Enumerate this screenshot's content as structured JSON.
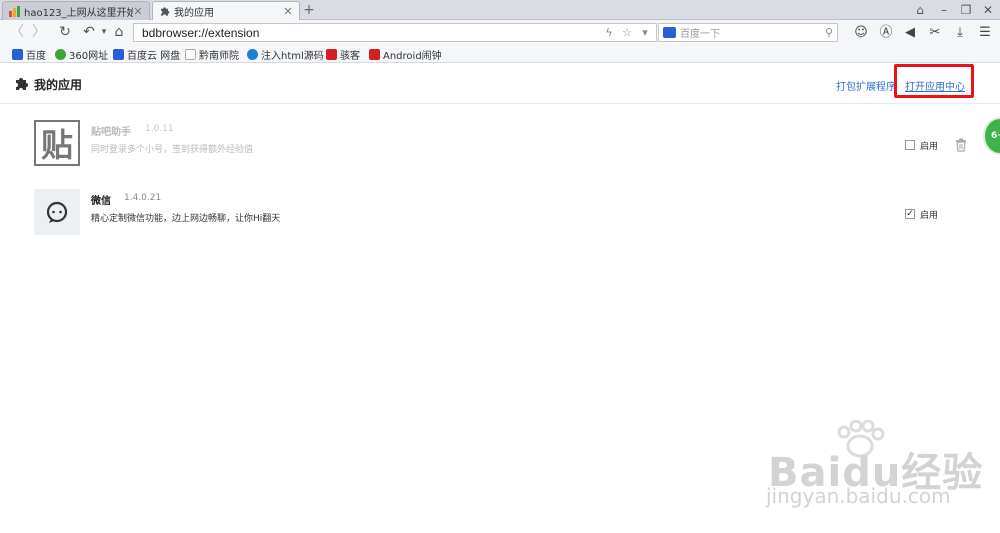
{
  "tabs": [
    {
      "title": "hao123_上网从这里开始",
      "active": false
    },
    {
      "title": "我的应用",
      "active": true
    }
  ],
  "window_controls": [
    "shirt-icon",
    "minimize-icon",
    "restore-icon",
    "close-icon"
  ],
  "address_bar": {
    "url": "bdbrowser://extension"
  },
  "search_box": {
    "placeholder": "百度一下"
  },
  "bookmarks": [
    {
      "label": "百度",
      "color": "#2b5ed9"
    },
    {
      "label": "360网址",
      "color": "#3aa53a"
    },
    {
      "label": "百度云 网盘",
      "color": "#2b5ed9"
    },
    {
      "label": "黔南师院",
      "color": "#cccccc"
    },
    {
      "label": "注入html源码",
      "color": "#1b7fd3"
    },
    {
      "label": "骇客",
      "color": "#d21f1f"
    },
    {
      "label": "Android闹钟",
      "color": "#d21f1f"
    }
  ],
  "page": {
    "title": "我的应用",
    "pack_link": "打包扩展程序",
    "open_center_link": "打开应用中心"
  },
  "extensions": [
    {
      "name": "贴吧助手",
      "version": "1.0.11",
      "description": "同时登录多个小号，签到获得额外经验值",
      "enabled": false,
      "enable_label": "启用",
      "icon_text": "贴"
    },
    {
      "name": "微信",
      "version": "1.4.0.21",
      "description": "精心定制微信功能，边上网边畅聊，让你Hi翻天",
      "enabled": true,
      "enable_label": "启用"
    }
  ],
  "floating_badge": "6+",
  "watermark": {
    "brand": "Baidu经验",
    "sub": "jingyan.baidu.com"
  },
  "colors": {
    "link": "#2e6fcf",
    "highlight": "#e8131b",
    "badge": "#3eb24b"
  }
}
